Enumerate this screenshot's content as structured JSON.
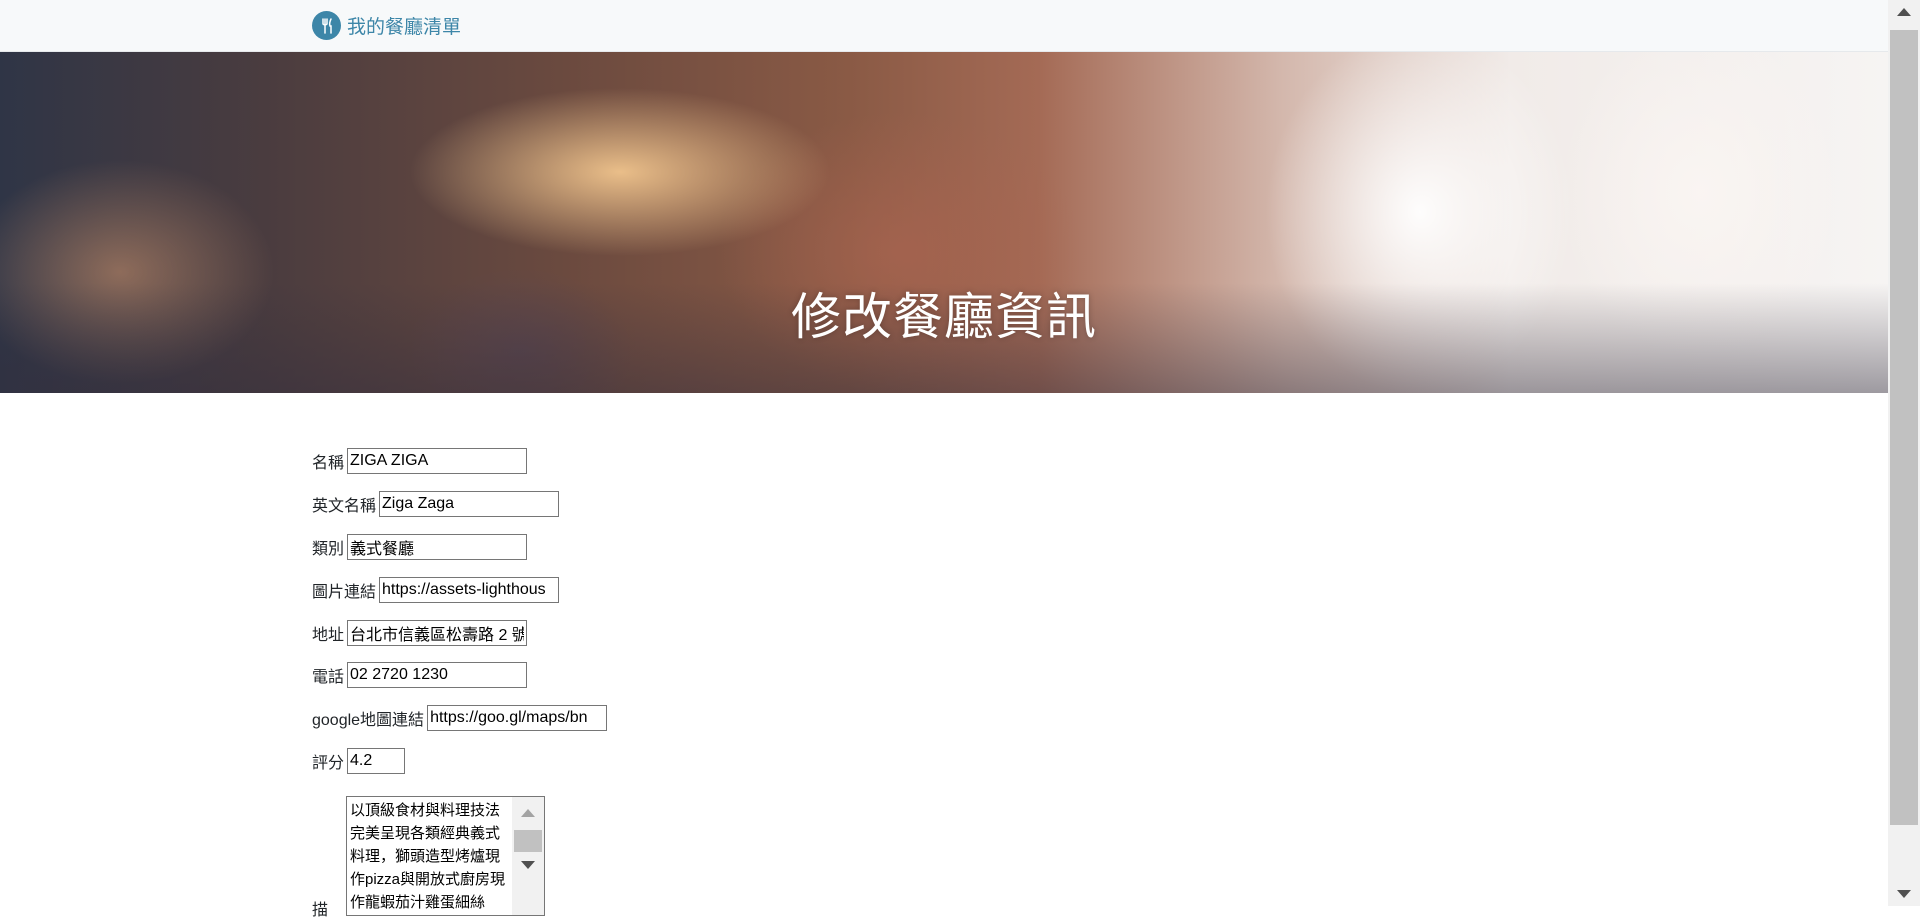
{
  "navbar": {
    "brand_icon": "utensils-icon",
    "brand_text": "我的餐廳清單",
    "brand_color": "#3d86a8"
  },
  "banner": {
    "title": "修改餐廳資訊"
  },
  "form": {
    "name": {
      "label": "名稱",
      "value": "ZIGA ZIGA"
    },
    "name_en": {
      "label": "英文名稱",
      "value": "Ziga Zaga"
    },
    "category": {
      "label": "類別",
      "value": "義式餐廳"
    },
    "image": {
      "label": "圖片連結",
      "value": "https://assets-lighthous"
    },
    "location": {
      "label": "地址",
      "value": "台北市信義區松壽路 2 號"
    },
    "phone": {
      "label": "電話",
      "value": "02 2720 1230"
    },
    "google_map": {
      "label": "google地圖連結",
      "value": "https://goo.gl/maps/bn"
    },
    "rating": {
      "label": "評分",
      "value": "4.2"
    },
    "description": {
      "label": "描",
      "value": "以頂級食材與料理技法完美呈現各類經典義式料理，獅頭造型烤爐現作pizza與開放式廚房現作龍蝦茄汁雞蛋細絲"
    }
  }
}
